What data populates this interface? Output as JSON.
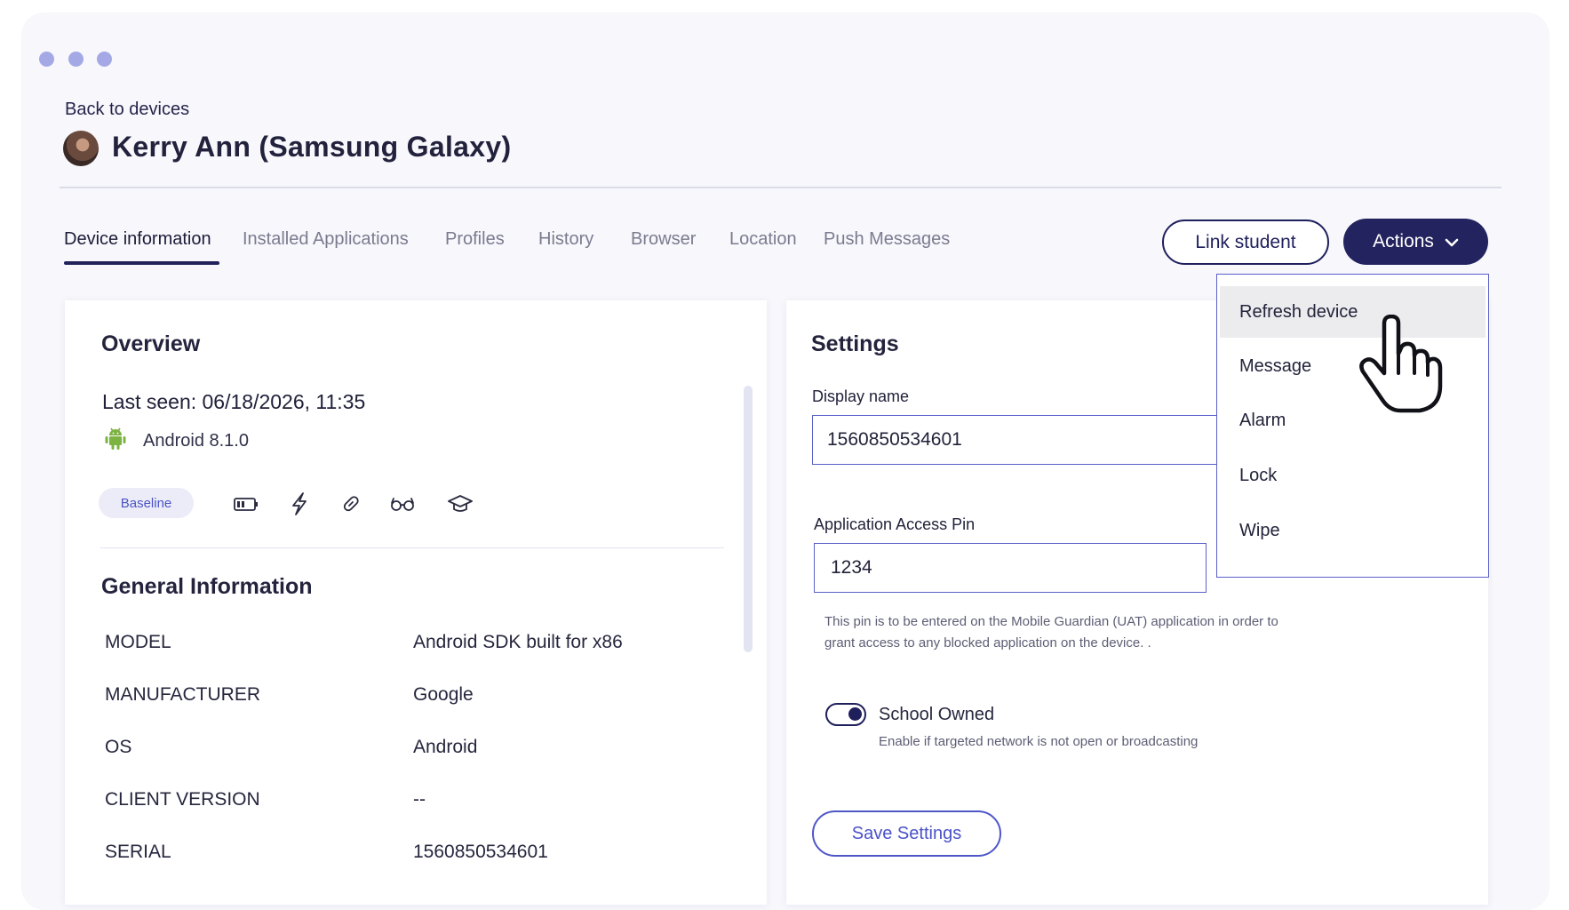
{
  "header": {
    "back_label": "Back to devices",
    "title": "Kerry Ann (Samsung Galaxy)"
  },
  "tabs": [
    {
      "label": "Device information",
      "active": true
    },
    {
      "label": "Installed Applications"
    },
    {
      "label": "Profiles"
    },
    {
      "label": "History"
    },
    {
      "label": "Browser"
    },
    {
      "label": "Location"
    },
    {
      "label": "Push Messages"
    }
  ],
  "toolbar": {
    "link_student_label": "Link student",
    "actions_label": "Actions"
  },
  "actions_menu": {
    "items": [
      "Refresh device",
      "Message",
      "Alarm",
      "Lock",
      "Wipe"
    ],
    "hovered": "Refresh device"
  },
  "overview": {
    "title": "Overview",
    "last_seen": "Last seen: 06/18/2026, 11:35",
    "os_version": "Android 8.1.0",
    "badge": "Baseline",
    "status_icons": [
      "battery-icon",
      "lightning-icon",
      "link-icon",
      "glasses-icon",
      "graduation-cap-icon"
    ]
  },
  "general_info": {
    "title": "General Information",
    "rows": [
      {
        "key": "MODEL",
        "value": "Android SDK built for x86"
      },
      {
        "key": "MANUFACTURER",
        "value": "Google"
      },
      {
        "key": "OS",
        "value": "Android"
      },
      {
        "key": "CLIENT VERSION",
        "value": "--"
      },
      {
        "key": "SERIAL",
        "value": "1560850534601"
      }
    ]
  },
  "settings": {
    "title": "Settings",
    "display_name_label": "Display name",
    "display_name_value": "1560850534601",
    "pin_label": "Application Access Pin",
    "pin_value": "1234",
    "pin_hint": "This pin is to be entered on the Mobile Guardian (UAT) application in order to grant access to any blocked application on the device. .",
    "school_owned_label": "School Owned",
    "school_owned_desc": "Enable if targeted network is not open or broadcasting",
    "school_owned_on": true,
    "save_label": "Save Settings"
  },
  "colors": {
    "primary": "#23235f",
    "accent": "#4f56c8",
    "dot": "#a4a9e6",
    "android_green": "#7cb342"
  }
}
